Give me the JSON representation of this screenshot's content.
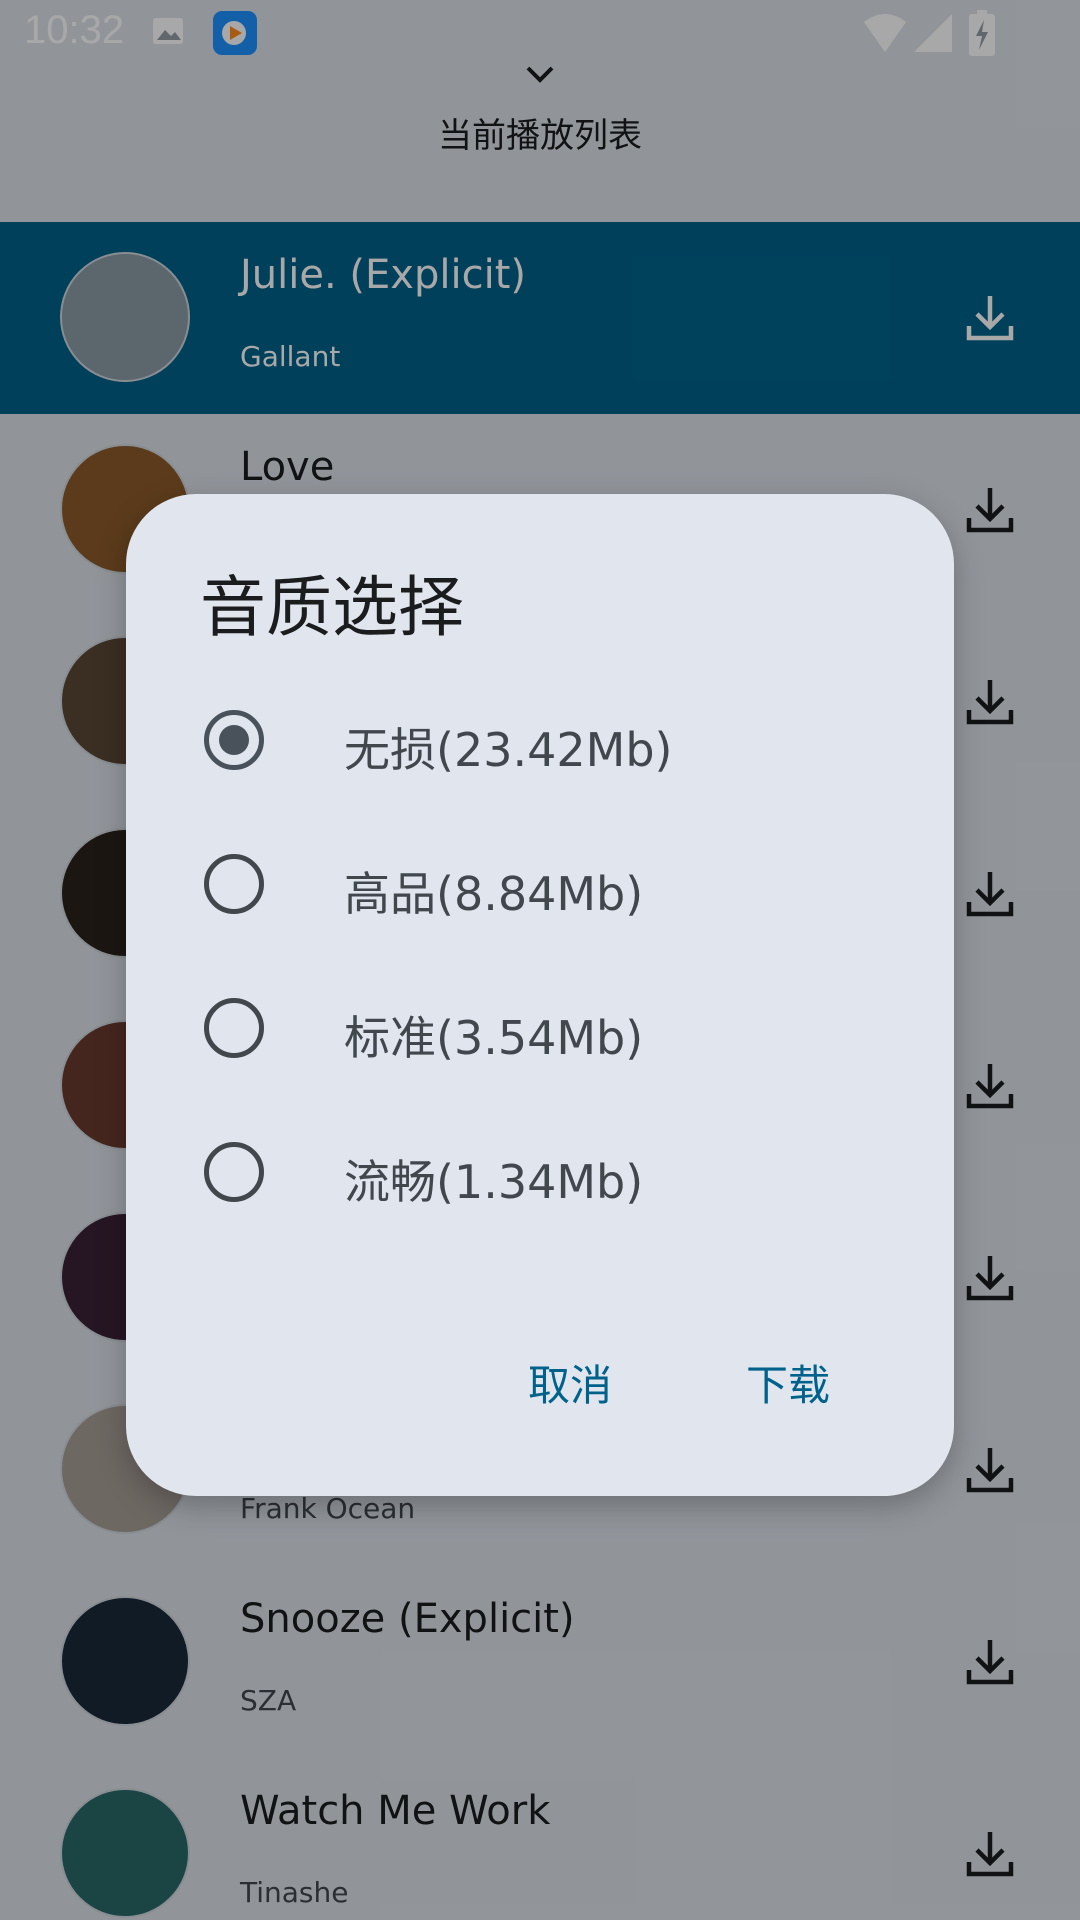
{
  "status_bar": {
    "time": "10:32"
  },
  "header": {
    "chevron_icon": "chevron-down-icon",
    "title": "当前播放列表"
  },
  "songs": [
    {
      "title": "Julie. (Explicit)",
      "artist": "Gallant",
      "active": true,
      "art_color": "#8a9ba6"
    },
    {
      "title": "Love",
      "artist": "",
      "active": false,
      "art_color": "#8a5a2a"
    },
    {
      "title": "",
      "artist": "",
      "active": false,
      "art_color": "#5a4636"
    },
    {
      "title": "",
      "artist": "",
      "active": false,
      "art_color": "#2a221c"
    },
    {
      "title": "",
      "artist": "",
      "active": false,
      "art_color": "#6a3a30"
    },
    {
      "title": "",
      "artist": "",
      "active": false,
      "art_color": "#3a2236"
    },
    {
      "title": "",
      "artist": "Frank Ocean",
      "active": false,
      "art_color": "#a89e96"
    },
    {
      "title": "Snooze (Explicit)",
      "artist": "SZA",
      "active": false,
      "art_color": "#1a2a3a"
    },
    {
      "title": "Watch Me Work",
      "artist": "Tinashe",
      "active": false,
      "art_color": "#2a6a6a"
    }
  ],
  "dialog": {
    "title": "音质选择",
    "options": [
      {
        "label": "无损(23.42Mb)",
        "checked": true
      },
      {
        "label": "高品(8.84Mb)",
        "checked": false
      },
      {
        "label": "标准(3.54Mb)",
        "checked": false
      },
      {
        "label": "流畅(1.34Mb)",
        "checked": false
      }
    ],
    "cancel_label": "取消",
    "confirm_label": "下载"
  },
  "colors": {
    "accent": "#00628b",
    "dialog_bg": "#e1e6ee"
  }
}
